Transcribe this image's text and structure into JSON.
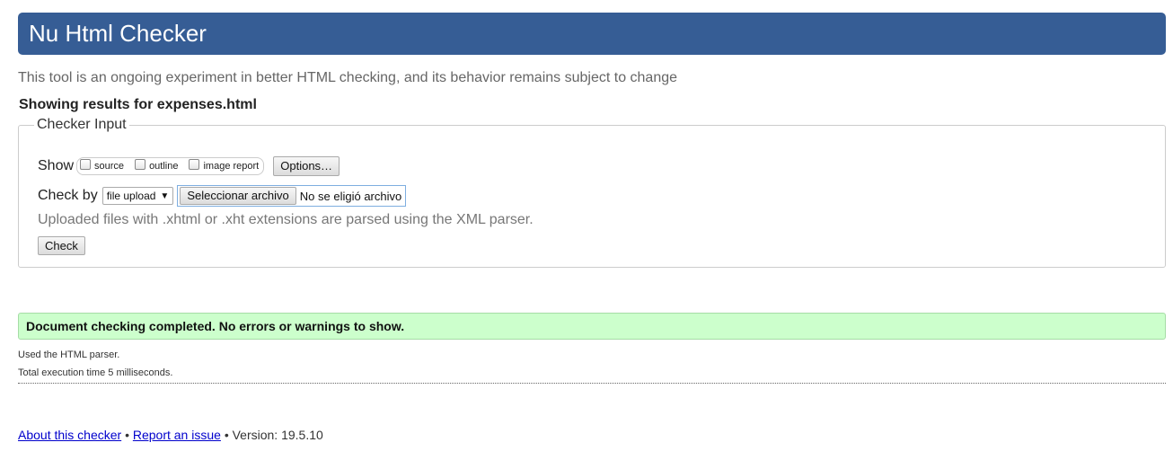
{
  "header": {
    "title": "Nu Html Checker"
  },
  "intro": "This tool is an ongoing experiment in better HTML checking, and its behavior remains subject to change",
  "showing": "Showing results for expenses.html",
  "checker_input": {
    "legend": "Checker Input",
    "show_label": "Show",
    "show_options": [
      {
        "label": "source",
        "checked": false
      },
      {
        "label": "outline",
        "checked": false
      },
      {
        "label": "image report",
        "checked": false
      }
    ],
    "options_button": "Options…",
    "check_by_label": "Check by",
    "check_by_value": "file upload",
    "file_button": "Seleccionar archivo",
    "file_status": "No se eligió archivo",
    "hint": "Uploaded files with .xhtml or .xht extensions are parsed using the XML parser.",
    "check_button": "Check"
  },
  "result": {
    "message": "Document checking completed. No errors or warnings to show.",
    "parser": "Used the HTML parser.",
    "time": "Total execution time 5 milliseconds."
  },
  "footer": {
    "about_link": "About this checker",
    "bullet": "•",
    "report_link": "Report an issue",
    "version": "Version: 19.5.10"
  },
  "colors": {
    "header_bg": "#365d95",
    "success_bg": "#ccffcc",
    "link": "#0000cc"
  }
}
